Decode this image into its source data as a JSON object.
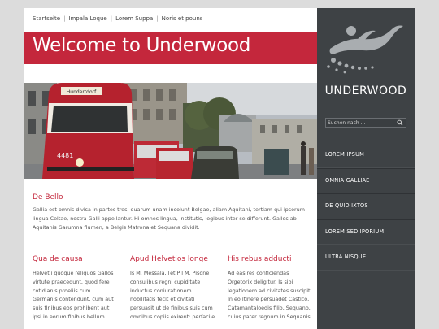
{
  "nav": {
    "items": [
      "Startseite",
      "Impala Loque",
      "Lorem Suppa",
      "Noris et pouns"
    ],
    "separator": "|"
  },
  "page_title": "Welcome to Underwood",
  "hero": {
    "sign_text": "Hundertdorf",
    "tram_number": "4481"
  },
  "intro": {
    "heading": "De Bello",
    "text": "Gallia est omnis divisa in partes tres, quarum unam incolunt Belgae, aliam Aquitani, tertiam qui ipsorum lingua Celtae, nostra Galli appellantur. Hi omnes lingua, institutis, legibus inter se differunt. Gallos ab Aquitanis Garumna flumen, a Belgis Matrona et Sequana dividit."
  },
  "columns": [
    {
      "heading": "Qua de causa",
      "lines": [
        "Helvetii quoque reliquos Gallos",
        "virtute praecedunt, quod fere",
        "cotidianis proeliis cum",
        "Germanis contendunt, cum aut",
        "suis finibus eos prohibent aut",
        "ipsi in eorum finibus bellum"
      ]
    },
    {
      "heading": "Apud Helvetios longe",
      "lines": [
        "Is M. Messala, [et P.] M. Pisone",
        "consulibus regni cupiditate",
        "inductus coniurationem",
        "nobilitatis fecit et civitati",
        "persuasit ut de finibus suis cum",
        "omnibus copiis exirent: perfacile"
      ]
    },
    {
      "heading": "His rebus adducti",
      "lines": [
        "Ad eas res conficiendas",
        "Orgetorix deligitur. Is sibi",
        "legationem ad civitates suscipit.",
        "In eo itinere persuadet Castico,",
        "Catamantaloedis filio, Sequano,",
        "cuius pater regnum in Sequanis"
      ]
    }
  ],
  "sidebar": {
    "logo_text": "UNDERWOOD",
    "search_placeholder": "Suchen nach ...",
    "menu": [
      "LOREM IPSUM",
      "OMNIA GALLIAE",
      "DE QUID IXTOS",
      "LOREM SED IPORIUM",
      "ULTRA NISQUE"
    ]
  },
  "colors": {
    "accent": "#c4273c",
    "sidebar_bg": "#3e4245",
    "page_bg": "#dcdcdc"
  },
  "icons": [
    "search-icon",
    "swimmer-logo-icon"
  ]
}
